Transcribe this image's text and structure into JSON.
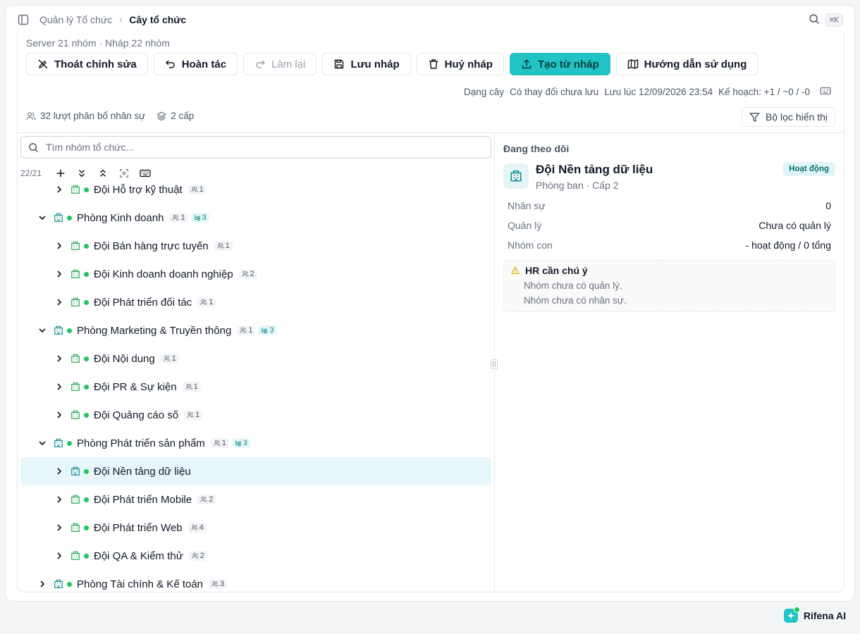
{
  "breadcrumb": {
    "parent": "Quản lý Tổ chức",
    "current": "Cây tổ chức"
  },
  "search_shortcut": "⌘K",
  "summary": "Server 21 nhóm · Nháp 22 nhóm",
  "toolbar": {
    "exit_edit": "Thoát chỉnh sửa",
    "undo": "Hoàn tác",
    "redo": "Làm lại",
    "save_draft": "Lưu nháp",
    "discard_draft": "Huỷ nháp",
    "create_from_draft": "Tạo từ nháp",
    "guide": "Hướng dẫn sử dụng"
  },
  "status": {
    "view_mode": "Dạng cây",
    "unsaved": "Có thay đổi chưa lưu",
    "saved_at": "Lưu lúc 12/09/2026 23:54",
    "plan": "Kế hoạch: +1 / ~0 / -0"
  },
  "stats": {
    "assignments": "32 lượt phân bổ nhân sự",
    "levels": "2 cấp"
  },
  "filter_label": "Bộ lọc hiển thị",
  "tree_search": {
    "placeholder": "Tìm nhóm tổ chức..."
  },
  "tree_count": "22/21",
  "tree": [
    {
      "label": "Đội Hỗ trợ kỹ thuật",
      "level": 2,
      "expanded": false,
      "people": "1",
      "sub": null,
      "selected": false
    },
    {
      "label": "Phòng Kinh doanh",
      "level": 1,
      "expanded": true,
      "people": "1",
      "sub": "3",
      "selected": false
    },
    {
      "label": "Đội Bán hàng trực tuyến",
      "level": 2,
      "expanded": false,
      "people": "1",
      "sub": null,
      "selected": false
    },
    {
      "label": "Đội Kinh doanh doanh nghiệp",
      "level": 2,
      "expanded": false,
      "people": "2",
      "sub": null,
      "selected": false
    },
    {
      "label": "Đội Phát triển đối tác",
      "level": 2,
      "expanded": false,
      "people": "1",
      "sub": null,
      "selected": false
    },
    {
      "label": "Phòng Marketing & Truyền thông",
      "level": 1,
      "expanded": true,
      "people": "1",
      "sub": "3",
      "selected": false
    },
    {
      "label": "Đội Nội dung",
      "level": 2,
      "expanded": false,
      "people": "1",
      "sub": null,
      "selected": false
    },
    {
      "label": "Đội PR & Sự kiện",
      "level": 2,
      "expanded": false,
      "people": "1",
      "sub": null,
      "selected": false
    },
    {
      "label": "Đội Quảng cáo số",
      "level": 2,
      "expanded": false,
      "people": "1",
      "sub": null,
      "selected": false
    },
    {
      "label": "Phòng Phát triển sản phẩm",
      "level": 1,
      "expanded": true,
      "people": "1",
      "sub": "3",
      "selected": false
    },
    {
      "label": "Đội Nền tảng dữ liệu",
      "level": 2,
      "expanded": false,
      "people": null,
      "sub": null,
      "selected": true
    },
    {
      "label": "Đội Phát triển Mobile",
      "level": 2,
      "expanded": false,
      "people": "2",
      "sub": null,
      "selected": false
    },
    {
      "label": "Đội Phát triển Web",
      "level": 2,
      "expanded": false,
      "people": "4",
      "sub": null,
      "selected": false
    },
    {
      "label": "Đội QA & Kiểm thử",
      "level": 2,
      "expanded": false,
      "people": "2",
      "sub": null,
      "selected": false
    },
    {
      "label": "Phòng Tài chính & Kế toán",
      "level": 1,
      "expanded": false,
      "people": "3",
      "sub": null,
      "selected": false
    }
  ],
  "detail": {
    "watching_label": "Đang theo dõi",
    "name": "Đội Nền tảng dữ liệu",
    "meta": "Phòng ban · Cấp 2",
    "status": "Hoạt động",
    "rows": [
      {
        "key": "Nhân sự",
        "value": "0"
      },
      {
        "key": "Quản lý",
        "value": "Chưa có quản lý"
      },
      {
        "key": "Nhóm con",
        "value": "- hoạt động / 0 tổng"
      }
    ],
    "alert": {
      "title": "HR cần chú ý",
      "lines": [
        "Nhóm chưa có quản lý.",
        "Nhóm chưa có nhân sự."
      ]
    }
  },
  "ai_assistant": "Rifena AI",
  "colors": {
    "accent": "#22c3c6",
    "active_dot": "#22c55e",
    "selected_row": "#e6f6fb",
    "warning": "#eab308"
  }
}
